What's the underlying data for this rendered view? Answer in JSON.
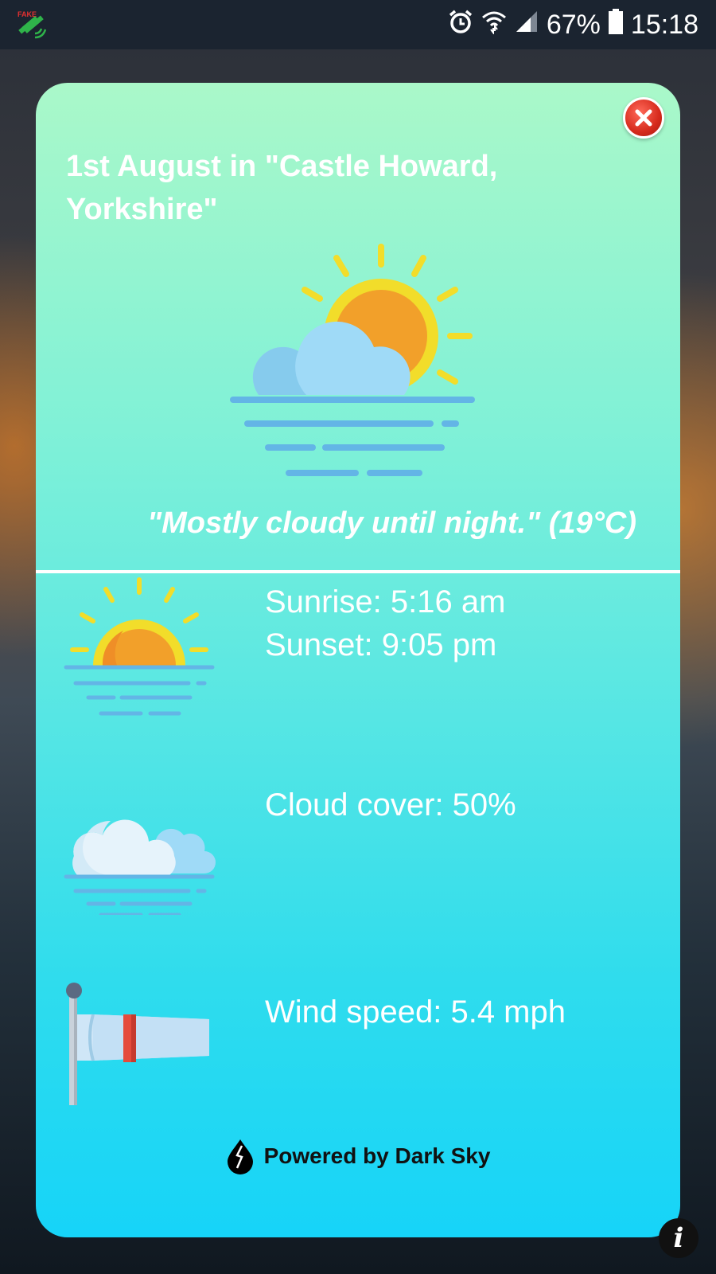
{
  "status_bar": {
    "battery_percent": "67%",
    "time": "15:18",
    "icons": [
      "satellite-app-icon",
      "alarm-icon",
      "wifi-icon",
      "signal-icon",
      "battery-icon"
    ]
  },
  "dialog": {
    "title": "1st August in \"Castle Howard, Yorkshire\"",
    "summary": "\"Mostly cloudy until night.\" (19°C)",
    "sunrise": "Sunrise: 5:16 am",
    "sunset": "Sunset: 9:05 pm",
    "cloud_cover": "Cloud cover: 50%",
    "wind_speed": "Wind speed: 5.4 mph",
    "footer": "Powered by Dark Sky"
  },
  "colors": {
    "card_top": "#aaf8c9",
    "card_bottom": "#16d4f8",
    "sun_yellow": "#f2dd2a",
    "sun_orange": "#f2a02a",
    "cloud_blue": "#9fdaf7",
    "line_blue": "#63b5e6",
    "windsock_red": "#e54b3c"
  }
}
